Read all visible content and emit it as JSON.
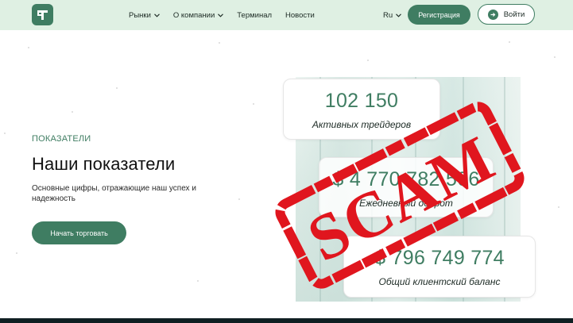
{
  "header": {
    "nav": [
      {
        "label": "Рынки",
        "has_dropdown": true
      },
      {
        "label": "О компании",
        "has_dropdown": true
      },
      {
        "label": "Терминал",
        "has_dropdown": false
      },
      {
        "label": "Новости",
        "has_dropdown": false
      }
    ],
    "language": "Ru",
    "register_label": "Регистрация",
    "login_label": "Войти"
  },
  "hero": {
    "eyebrow": "ПОКАЗАТЕЛИ",
    "title": "Наши показатели",
    "subtitle": "Основные цифры, отражающие наш успех и надежность",
    "cta_label": "Начать торговать"
  },
  "stats": [
    {
      "value": "102 150",
      "label": "Активных трейдеров"
    },
    {
      "value": "$ 4 770 782 506",
      "label": "Ежедневный оборот"
    },
    {
      "value": "$ 796 749 774",
      "label": "Общий клиентский баланс"
    }
  ],
  "stamp": {
    "text": "SCAM",
    "color": "#e0161e"
  },
  "colors": {
    "accent": "#3f7d62",
    "header_bg": "#dff0e3",
    "footer": "#0f1f22"
  }
}
